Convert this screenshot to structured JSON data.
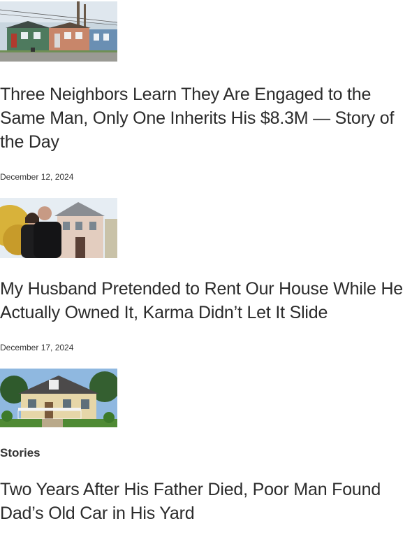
{
  "articles": [
    {
      "image": "row-houses-street-photo",
      "title": "Three Neighbors Learn They Are Engaged to the Same Man, Only One Inherits His $8.3M — Story of the Day",
      "date": "December 12, 2024"
    },
    {
      "image": "couple-in-front-of-house-photo",
      "title": "My Husband Pretended to Rent Our House While He Actually Owned It, Karma Didn’t Let It Slide",
      "date": "December 17, 2024"
    },
    {
      "image": "suburban-house-photo",
      "category": "Stories",
      "title": "Two Years After His Father Died, Poor Man Found Dad’s Old Car in His Yard"
    }
  ]
}
